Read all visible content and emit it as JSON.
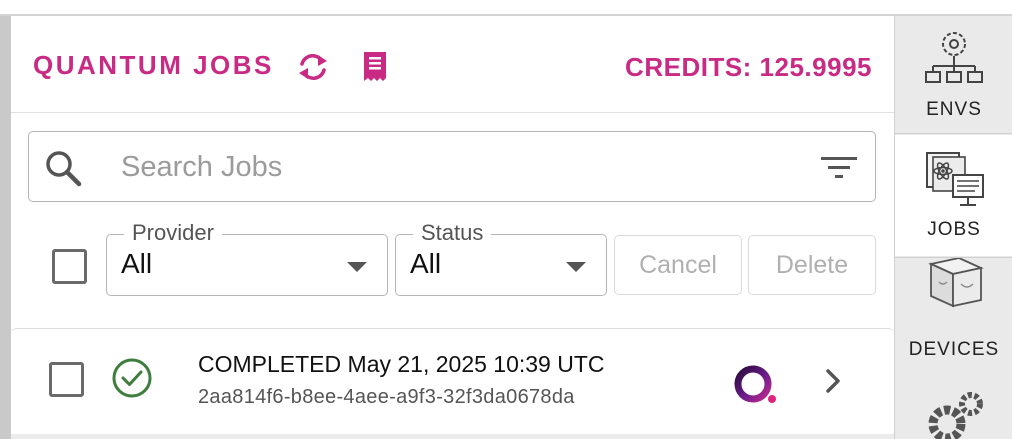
{
  "header": {
    "title": "QUANTUM JOBS",
    "credits": "CREDITS: 125.9995",
    "icons": [
      "refresh-icon",
      "receipt-icon"
    ]
  },
  "search": {
    "placeholder": "Search Jobs",
    "value": ""
  },
  "filters": {
    "provider": {
      "label": "Provider",
      "value": "All"
    },
    "status": {
      "label": "Status",
      "value": "All"
    }
  },
  "actions": {
    "cancel_label": "Cancel",
    "delete_label": "Delete"
  },
  "jobs": [
    {
      "status": "COMPLETED",
      "datetime": "May 21, 2025 10:39 UTC",
      "id": "2aa814f6-b8ee-4aee-a9f3-32f3da0678da",
      "status_icon": "check-circle-icon",
      "provider_icon": "provider-logo"
    }
  ],
  "sidebar": {
    "items": [
      {
        "label": "ENVS",
        "icon": "environments-icon"
      },
      {
        "label": "JOBS",
        "icon": "jobs-icon",
        "active": true
      },
      {
        "label": "DEVICES",
        "icon": "devices-icon"
      },
      {
        "label": "",
        "icon": "settings-icon"
      }
    ]
  },
  "colors": {
    "accent": "#c92a83",
    "success": "#3f7d3f",
    "sidebar_bg": "#eaeaea"
  }
}
